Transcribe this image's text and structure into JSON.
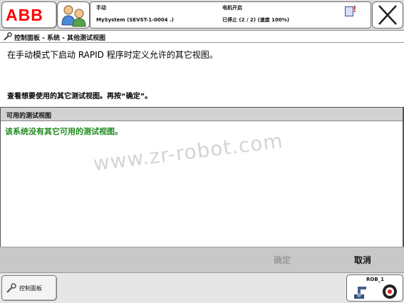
{
  "header": {
    "brand": "ABB",
    "status": {
      "mode": "手动",
      "system": "MySystem (SEVST-1-0004 .)",
      "motor_state": "电机开启",
      "program_state": "已停止 (2 / 2) (速度 100%)"
    }
  },
  "breadcrumb": {
    "text": "控制面板 - 系统 - 其他测试视图"
  },
  "main": {
    "description": "在手动模式下启动 RAPID 程序时定义允许的其它视图。",
    "instruction": "查看想要使用的其它测试视图。再按“确定”。",
    "list": {
      "header": "可用的测试视图",
      "empty_message": "该系统没有其它可用的测试视图。"
    },
    "watermark": "www.zr-robot.com"
  },
  "commands": {
    "ok_label": "确定",
    "cancel_label": "取消"
  },
  "taskbar": {
    "control_panel_label": "控制面板",
    "quickset_unit": "ROB_1"
  },
  "colors": {
    "accent_red": "#ff0000",
    "empty_text": "#1e8a1e",
    "disabled_text": "#9a9a9a"
  }
}
